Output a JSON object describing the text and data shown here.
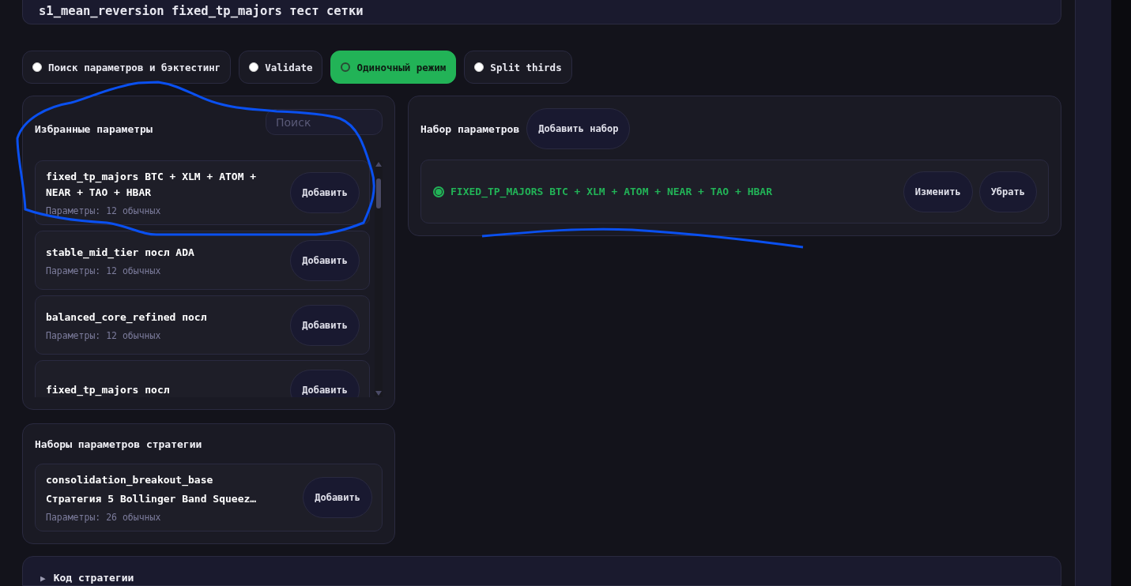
{
  "title": "s1_mean_reversion fixed_tp_majors тест сетки",
  "modes": [
    {
      "label": "Поиск параметров и бэктестинг",
      "selected": false
    },
    {
      "label": "Validate",
      "selected": false
    },
    {
      "label": "Одиночный режим",
      "selected": true
    },
    {
      "label": "Split thirds",
      "selected": false
    }
  ],
  "favorites": {
    "title": "Избранные параметры",
    "search": {
      "placeholder": "Поиск"
    },
    "items": [
      {
        "name": "fixed_tp_majors BTC + XLM + ATOM + NEAR + TAO + HBAR",
        "meta": "Параметры: 12 обычных",
        "button": "Добавить"
      },
      {
        "name": "stable_mid_tier посл ADA",
        "meta": "Параметры: 12 обычных",
        "button": "Добавить"
      },
      {
        "name": "balanced_core_refined посл",
        "meta": "Параметры: 12 обычных",
        "button": "Добавить"
      },
      {
        "name": "fixed_tp_majors посл",
        "button": "Добавить"
      }
    ]
  },
  "strategy_sets": {
    "title": "Наборы параметров стратегии",
    "items": [
      {
        "name": "consolidation_breakout_base",
        "subtitle": "Стратегия 5 Bollinger Band Squeez…",
        "meta": "Параметры: 26 обычных",
        "button": "Добавить"
      }
    ]
  },
  "param_set": {
    "title": "Набор параметров",
    "add_button": "Добавить набор",
    "items": [
      {
        "label": "FIXED_TP_MAJORS BTC + XLM + ATOM + NEAR + TAO + HBAR",
        "selected": true,
        "edit_button": "Изменить",
        "remove_button": "Убрать"
      }
    ]
  },
  "code_section": {
    "toggle": "▶",
    "title": "Код стратегии",
    "expanded": false
  }
}
